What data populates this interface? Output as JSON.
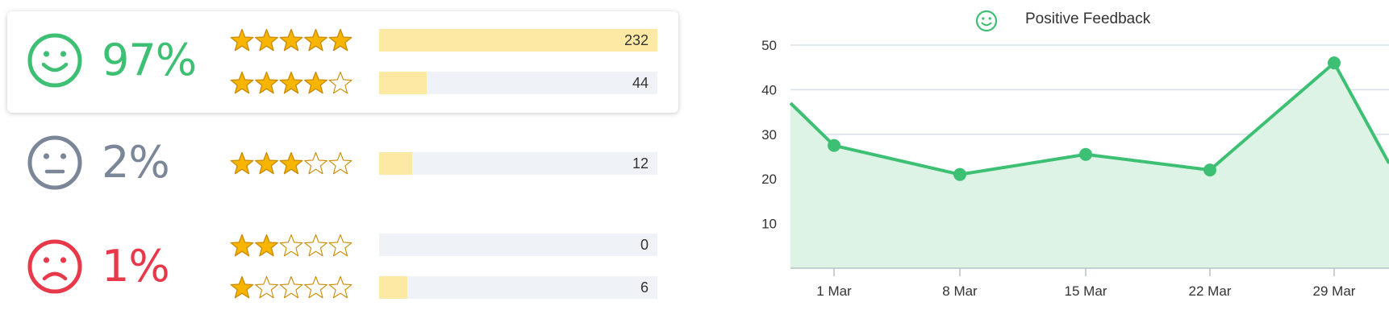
{
  "sentiment": [
    {
      "mood": "positive",
      "percent": "97%",
      "color": "#3ec074",
      "icon": "smiley-face-icon"
    },
    {
      "mood": "neutral",
      "percent": "2%",
      "color": "#7b8798",
      "icon": "neutral-face-icon"
    },
    {
      "mood": "negative",
      "percent": "1%",
      "color": "#e8394a",
      "icon": "sad-face-icon"
    }
  ],
  "ratings": [
    {
      "stars": 5,
      "count": "232",
      "fill": 1.0
    },
    {
      "stars": 4,
      "count": "44",
      "fill": 0.17
    },
    {
      "stars": 3,
      "count": "12",
      "fill": 0.12
    },
    {
      "stars": 2,
      "count": "0",
      "fill": 0.0
    },
    {
      "stars": 1,
      "count": "6",
      "fill": 0.1
    }
  ],
  "colors": {
    "star_fill": "#f7b500",
    "star_stroke": "#c98a00",
    "bar_fill": "#fde9a3",
    "bar_track": "#eff2f6",
    "line": "#3ec074",
    "area": "#dcf3e5",
    "grid": "#d8e2e6"
  },
  "chart_data": {
    "type": "area",
    "title": "",
    "legend": [
      {
        "name": "Positive Feedback",
        "icon": "smiley-face-icon",
        "position": "top-center"
      }
    ],
    "x_ticks": [
      "1 Mar",
      "8 Mar",
      "15 Mar",
      "22 Mar",
      "29 Mar"
    ],
    "y_ticks": [
      10,
      20,
      30,
      40,
      50
    ],
    "ylim": [
      0,
      50
    ],
    "grid": true,
    "series": [
      {
        "name": "Positive Feedback",
        "points": [
          {
            "x": "28 Feb",
            "y": 37
          },
          {
            "x": "1 Mar",
            "y": 27.5
          },
          {
            "x": "8 Mar",
            "y": 21
          },
          {
            "x": "15 Mar",
            "y": 25.5
          },
          {
            "x": "22 Mar",
            "y": 22
          },
          {
            "x": "29 Mar",
            "y": 46
          },
          {
            "x": "31 Mar",
            "y": 23.5
          }
        ],
        "markers": [
          "1 Mar",
          "8 Mar",
          "15 Mar",
          "22 Mar",
          "29 Mar"
        ]
      }
    ]
  }
}
